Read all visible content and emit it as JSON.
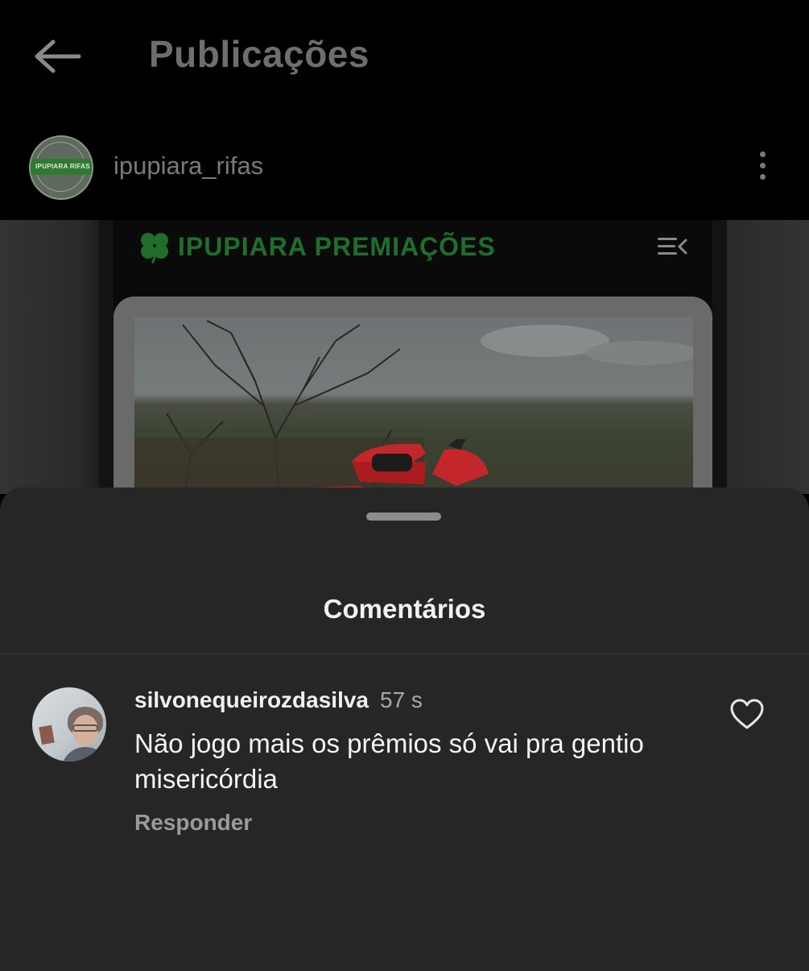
{
  "header": {
    "back_icon": "arrow-left-icon",
    "title": "Publicações"
  },
  "post": {
    "username": "ipupiara_rifas",
    "avatar_text": "IPUPIARA RIFAS",
    "more_icon": "more-vertical-icon",
    "image": {
      "brand_text": "IPUPIARA PREMIAÇÕES",
      "brand_icon": "clover-icon",
      "menu_icon": "menu-icon",
      "brand_color": "#1f6e2a"
    }
  },
  "comments_sheet": {
    "title": "Comentários",
    "comments": [
      {
        "username": "silvonequeirozdasilva",
        "time": "57 s",
        "text": "Não jogo mais os prêmios só vai pra gentio misericórdia",
        "reply_label": "Responder",
        "like_icon": "heart-outline-icon"
      }
    ]
  }
}
